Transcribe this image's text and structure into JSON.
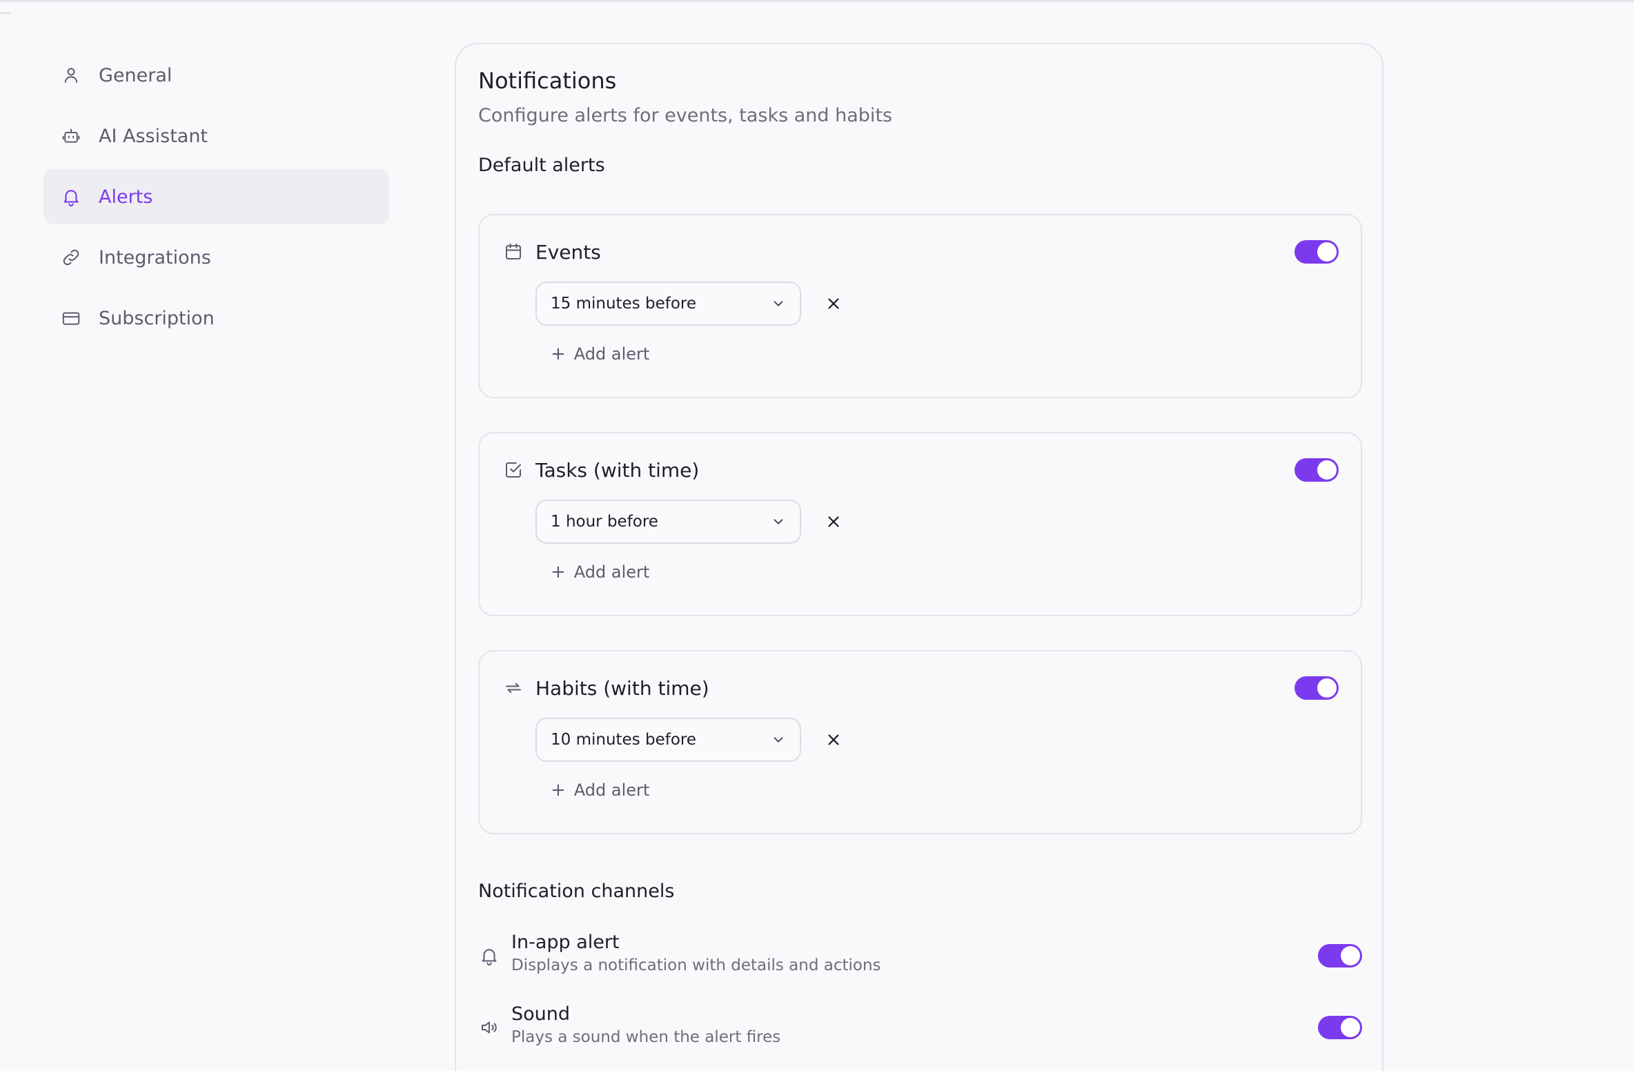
{
  "colors": {
    "accent": "#7c3aed",
    "background": "#f9f9fb",
    "border": "#e3e3ea",
    "muted_text": "#6b6e7c"
  },
  "sidebar": {
    "items": [
      {
        "label": "General",
        "icon": "user-icon",
        "active": false
      },
      {
        "label": "AI Assistant",
        "icon": "robot-icon",
        "active": false
      },
      {
        "label": "Alerts",
        "icon": "bell-icon",
        "active": true
      },
      {
        "label": "Integrations",
        "icon": "link-icon",
        "active": false
      },
      {
        "label": "Subscription",
        "icon": "credit-card-icon",
        "active": false
      }
    ]
  },
  "main": {
    "title": "Notifications",
    "subtitle": "Configure alerts for events, tasks and habits",
    "default_alerts_heading": "Default alerts",
    "alert_groups": [
      {
        "label": "Events",
        "icon": "calendar-icon",
        "enabled": true,
        "alert": "15 minutes before",
        "add_label": "Add alert"
      },
      {
        "label": "Tasks (with time)",
        "icon": "checkbox-icon",
        "enabled": true,
        "alert": "1 hour before",
        "add_label": "Add alert"
      },
      {
        "label": "Habits (with time)",
        "icon": "repeat-icon",
        "enabled": true,
        "alert": "10 minutes before",
        "add_label": "Add alert"
      }
    ],
    "channels_heading": "Notification channels",
    "channels": [
      {
        "title": "In-app alert",
        "description": "Displays a notification with details and actions",
        "icon": "bell-icon",
        "enabled": true
      },
      {
        "title": "Sound",
        "description": "Plays a sound when the alert fires",
        "icon": "speaker-icon",
        "enabled": true
      }
    ]
  }
}
